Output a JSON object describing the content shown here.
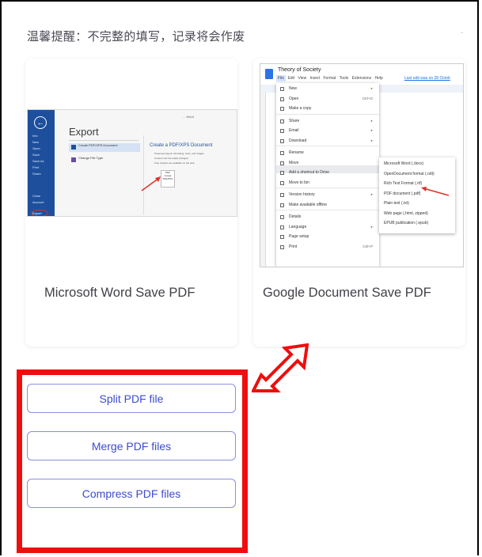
{
  "notice": "温馨提醒：不完整的填写，记录将会作废",
  "corner_mark": "-",
  "cards": [
    {
      "title": "Microsoft Word Save PDF",
      "screenshot": {
        "breadcrumb": "... Word",
        "heading": "Export",
        "nav": [
          "Info",
          "New",
          "Open",
          "Save",
          "Save As",
          "Print",
          "Share",
          "Export",
          "Close",
          "Account",
          "Options"
        ],
        "export_label": "Export",
        "items": [
          "Create PDF/XPS Document",
          "Change File Type"
        ],
        "right_title": "Create a PDF/XPS Document",
        "bullets": [
          "Preserves layout, formatting, fonts, and images",
          "Content can't be easily changed",
          "Free viewers are available on the web"
        ],
        "pdf_box": [
          "PDF",
          "Create",
          "PDF/XPS"
        ]
      }
    },
    {
      "title": "Google Document Save PDF",
      "screenshot": {
        "doc_title": "Theory of Society",
        "menubar": "File  Edit  View  Insert  Format  Tools  Extensions  Help",
        "last_edit": "Last edit was on 28 Octob",
        "menu_items": [
          {
            "label": "New",
            "shortcut": "▸"
          },
          {
            "label": "Open",
            "shortcut": "Ctrl+O"
          },
          {
            "label": "Make a copy",
            "shortcut": ""
          },
          {
            "label": "Share",
            "shortcut": "▸"
          },
          {
            "label": "Email",
            "shortcut": "▸"
          },
          {
            "label": "Download",
            "shortcut": "▸"
          },
          {
            "label": "Rename",
            "shortcut": ""
          },
          {
            "label": "Move",
            "shortcut": ""
          },
          {
            "label": "Add a shortcut to Drive",
            "shortcut": ""
          },
          {
            "label": "Move to bin",
            "shortcut": ""
          },
          {
            "label": "Version history",
            "shortcut": "▸"
          },
          {
            "label": "Make available offline",
            "shortcut": ""
          },
          {
            "label": "Details",
            "shortcut": ""
          },
          {
            "label": "Language",
            "shortcut": "▸"
          },
          {
            "label": "Page setup",
            "shortcut": ""
          },
          {
            "label": "Print",
            "shortcut": "Ctrl+P"
          }
        ],
        "submenu": [
          "Microsoft Word (.docx)",
          "OpenDocument format (.odt)",
          "Rich Text Format (.rtf)",
          "PDF document (.pdf)",
          "Plain text (.txt)",
          "Web page (.html, zipped)",
          "EPUB publication (.epub)"
        ]
      }
    }
  ],
  "buttons": {
    "split": "Split PDF file",
    "merge": "Merge PDF files",
    "compress": "Compress PDF files"
  },
  "colors": {
    "highlight": "#ee0e0e",
    "button_text": "#3d4ad2",
    "button_border": "#8a8ee0"
  }
}
